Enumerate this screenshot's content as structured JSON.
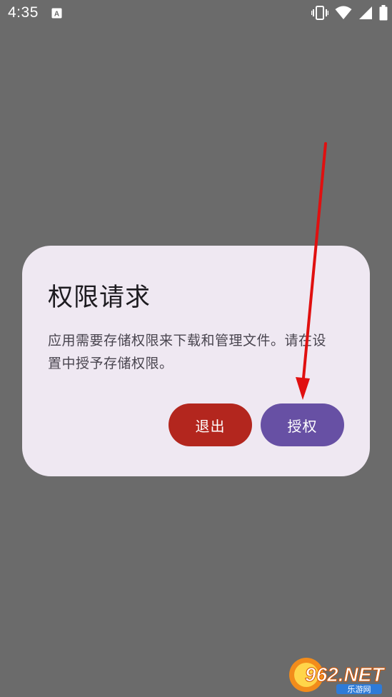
{
  "status_bar": {
    "time": "4:35",
    "notification_icon": "a-keyboard-icon",
    "icons": [
      "vibrate-icon",
      "wifi-icon",
      "signal-icon",
      "battery-icon"
    ]
  },
  "dialog": {
    "title": "权限请求",
    "message": "应用需要存储权限来下载和管理文件。请在设置中授予存储权限。",
    "buttons": {
      "exit_label": "退出",
      "grant_label": "授权"
    }
  },
  "watermark": {
    "brand": "962.NET",
    "subtitle": "乐游网"
  },
  "colors": {
    "background": "#6b6b6b",
    "dialog_bg": "#efe8f2",
    "exit_button": "#b3261e",
    "grant_button": "#6750a4",
    "arrow": "#e01010"
  }
}
